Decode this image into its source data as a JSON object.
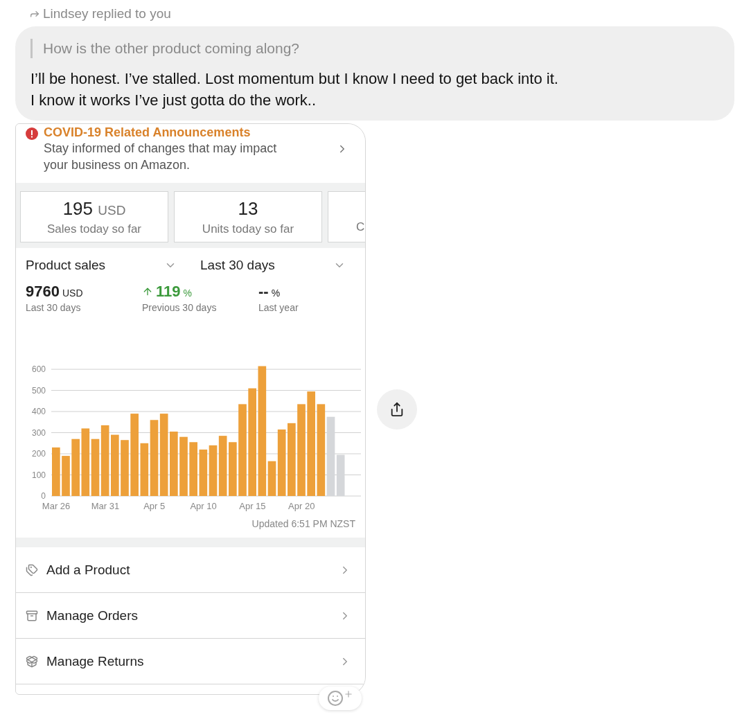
{
  "reply_header": {
    "text": "Lindsey replied to you"
  },
  "message": {
    "quote": "How is the other product coming along?",
    "text": "I’ll be honest. I’ve stalled. Lost momentum but I know I need to get back into it.\nI know it works I’ve just gotta do the work.."
  },
  "attachment": {
    "announcement": {
      "title": "COVID-19 Related Announcements",
      "text": "Stay informed of changes that may impact your business on Amazon."
    },
    "stat_cards": [
      {
        "value": "195",
        "unit": "USD",
        "label": "Sales today so far"
      },
      {
        "value": "13",
        "label": "Units today so far"
      },
      {
        "label": "C"
      }
    ],
    "selectors": [
      {
        "label": "Product sales"
      },
      {
        "label": "Last 30 days"
      }
    ],
    "metrics": [
      {
        "kind": "plain",
        "value": "9760",
        "unit": "USD",
        "label": "Last 30 days"
      },
      {
        "kind": "up",
        "value": "119",
        "unit": "%",
        "label": "Previous 30 days"
      },
      {
        "kind": "plain",
        "value": "--",
        "unit": "%",
        "label": "Last year"
      }
    ],
    "chart_data": {
      "type": "bar",
      "categories": [
        "Mar 26",
        null,
        null,
        null,
        null,
        "Mar 31",
        null,
        null,
        null,
        null,
        "Apr 5",
        null,
        null,
        null,
        null,
        "Apr 10",
        null,
        null,
        null,
        null,
        "Apr 15",
        null,
        null,
        null,
        null,
        "Apr 20",
        null,
        null,
        null,
        null
      ],
      "series": [
        {
          "color": "#eda03a",
          "values": [
            230,
            190,
            270,
            320,
            270,
            335,
            290,
            265,
            390,
            250,
            360,
            390,
            305,
            280,
            255,
            220,
            240,
            285,
            255,
            435,
            510,
            615,
            165,
            315,
            345,
            435,
            495,
            435,
            null,
            null
          ]
        },
        {
          "color": "#d5d7da",
          "values": [
            null,
            null,
            null,
            null,
            null,
            null,
            null,
            null,
            null,
            null,
            null,
            null,
            null,
            null,
            null,
            null,
            null,
            null,
            null,
            null,
            null,
            null,
            null,
            null,
            null,
            null,
            null,
            null,
            375,
            195
          ]
        }
      ],
      "ylim": [
        0,
        620
      ],
      "grid": true,
      "yticks": [
        0,
        100,
        200,
        300,
        400,
        500,
        600
      ]
    },
    "updated": "Updated 6:51 PM NZST",
    "menu": [
      {
        "label": "Add a Product"
      },
      {
        "label": "Manage Orders"
      },
      {
        "label": "Manage Returns"
      }
    ]
  }
}
